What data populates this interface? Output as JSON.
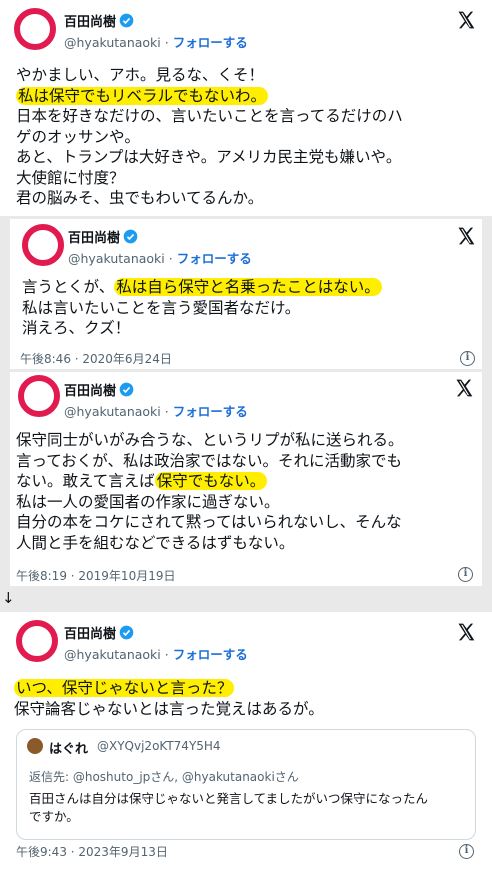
{
  "account": {
    "name": "百田尚樹",
    "handle": "@hyakutanaoki",
    "separator": "·",
    "follow_label": "フォローする"
  },
  "colors": {
    "avatar_ring": "#e11a4f",
    "verified": "#1d9bf0",
    "follow": "#1d6fd8",
    "highlight": "#ffee00"
  },
  "tweet1": {
    "l1": "やかましい、アホ。見るな、くそ！",
    "l2_hl": "私は保守でもリベラルでもないわ。",
    "l3": "日本を好きなだけの、言いたいことを言ってるだけのハ",
    "l4": "ゲのオッサンや。",
    "l5": "あと、トランプは大好きや。アメリカ民主党も嫌いや。",
    "l6": "大使館に忖度？",
    "l7": "君の脳みそ、虫でもわいてるんか。"
  },
  "tweet2": {
    "l1_pre": "言うとくが、",
    "l1_hl": "私は自ら保守と名乗ったことはない。",
    "l2": "私は言いたいことを言う愛国者なだけ。",
    "l3": "消えろ、クズ！",
    "timestamp": "午後8:46 · 2020年6月24日"
  },
  "tweet3": {
    "l1": "保守同士がいがみ合うな、というリプが私に送られる。",
    "l2": "言っておくが、私は政治家ではない。それに活動家でも",
    "l3_pre": "ない。敢えて言えば",
    "l3_hl": "保守でもない。",
    "l4": "私は一人の愛国者の作家に過ぎない。",
    "l5": "自分の本をコケにされて黙ってはいられないし、そんな",
    "l6": "人間と手を組むなどできるはずもない。",
    "timestamp": "午後8:19 · 2019年10月19日"
  },
  "arrow": "↓",
  "tweet4": {
    "l1_hl": "いつ、保守じゃないと言った？",
    "l2": "保守論客じゃないとは言った覚えはあるが。",
    "timestamp": "午後9:43 · 2023年9月13日",
    "quote": {
      "name": "はぐれ",
      "handle": "@XYQvj2oKT74Y5H4",
      "reply_to": "返信先: @hoshuto_jpさん, @hyakutanaokiさん",
      "text1": "百田さんは自分は保守じゃないと発言してましたがいつ保守になったん",
      "text2": "ですか。"
    }
  },
  "icons": {
    "info": "info-icon",
    "x": "x-logo-icon",
    "verified": "verified-badge-icon"
  },
  "info_glyph": "i"
}
